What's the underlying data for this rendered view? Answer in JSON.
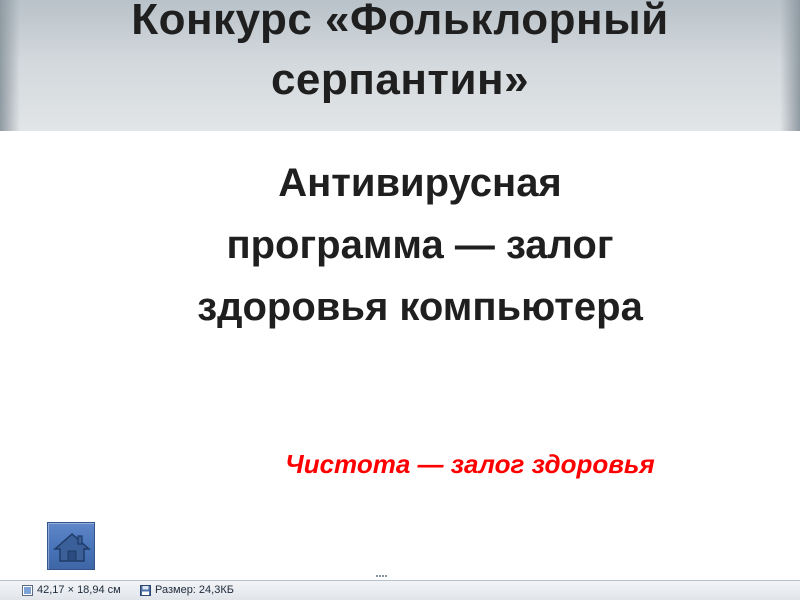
{
  "slide": {
    "title_line1": "Конкурс «Фольклорный",
    "title_line2": "серпантин»",
    "subtitle_line1": "Антивирусная",
    "subtitle_line2": "программа — залог",
    "subtitle_line3": "здоровья компьютера",
    "slogan": "Чистота — залог здоровья",
    "slogan_color": "#ff0000"
  },
  "nav": {
    "home_icon": "home-icon"
  },
  "status_bar": {
    "dimensions": "42,17 × 18,94 см",
    "size": "Размер: 24,3КБ",
    "dimensions_icon": "dimensions-icon",
    "size_icon": "disk-icon"
  }
}
